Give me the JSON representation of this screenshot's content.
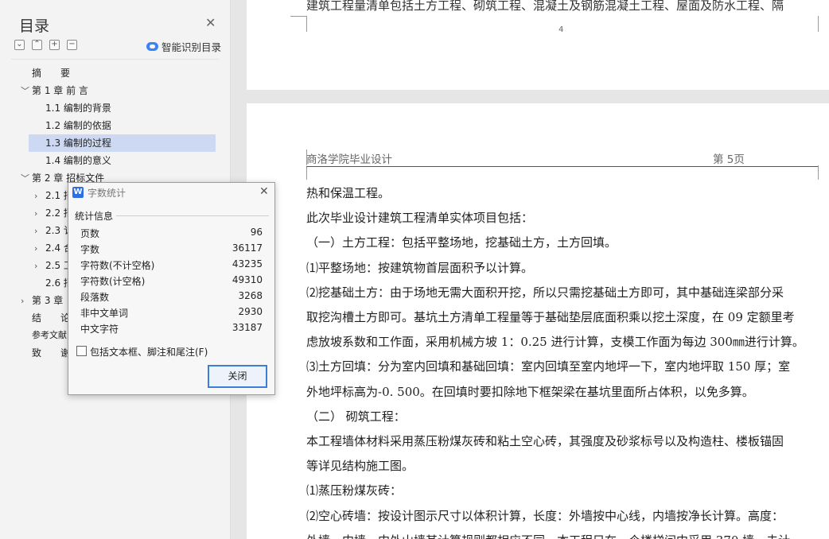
{
  "toc": {
    "title": "目录",
    "smart_label": "智能识别目录",
    "items": [
      {
        "label": "摘　　要"
      },
      {
        "label": "第 1 章  前  言"
      },
      {
        "label": "1.1 编制的背景"
      },
      {
        "label": "1.2 编制的依据"
      },
      {
        "label": "1.3 编制的过程"
      },
      {
        "label": "1.4 编制的意义"
      },
      {
        "label": "第 2 章  招标文件"
      },
      {
        "label": "2.1 招"
      },
      {
        "label": "2.2 招"
      },
      {
        "label": "2.3 讠"
      },
      {
        "label": "2.4 合"
      },
      {
        "label": "2.5 工"
      },
      {
        "label": "2.6 招"
      },
      {
        "label": "第 3 章"
      },
      {
        "label": "结　　论"
      },
      {
        "label": "参考文献"
      },
      {
        "label": "致　　谢"
      }
    ]
  },
  "document": {
    "prev_page_cut_text": "建筑工程量清单包括土方工程、砌筑工程、混凝土及钢筋混凝土工程、屋面及防水工程、隔",
    "prev_page_number": "4",
    "header_left": "商洛学院毕业设计",
    "header_right": "第 5页",
    "lines": [
      "热和保温工程。",
      "此次毕业设计建筑工程清单实体项目包括：",
      "（一）土方工程：包括平整场地，挖基础土方，土方回填。",
      "⑴平整场地：按建筑物首层面积予以计算。",
      "⑵挖基础土方：由于场地无需大面积开挖，所以只需挖基础土方即可，其中基础连梁部分采",
      "取挖沟槽土方即可。基坑土方清单工程量等于基础垫层底面积乘以挖土深度，在 09 定额里考",
      "虑放坡系数和工作面，采用机械方坡 1：0.25 进行计算，支模工作面为每边 300㎜进行计算。",
      "⑶土方回填：分为室内回填和基础回填：室内回填至室内地坪一下，室内地坪取 150 厚；室",
      "外地坪标高为-0. 500。在回填时要扣除地下框架梁在基坑里面所占体积，以免多算。",
      "（二） 砌筑工程：",
      "本工程墙体材料采用蒸压粉煤灰砖和粘土空心砖，其强度及砂浆标号以及构造柱、楼板锚固",
      "等详见结构施工图。",
      "⑴蒸压粉煤灰砖：",
      "⑵空心砖墙：按设计图示尺寸以体积计算，长度：外墙按中心线，内墙按净长计算。高度：",
      "外墙、内墙、内外山墙其计算规则都相应不同。本工程只在一个楼梯间中采用 370 墙，未计"
    ]
  },
  "dialog": {
    "title": "字数统计",
    "section": "统计信息",
    "stats": [
      {
        "label": "页数",
        "value": "96"
      },
      {
        "label": "字数",
        "value": "36117"
      },
      {
        "label": "字符数(不计空格)",
        "value": "43235"
      },
      {
        "label": "字符数(计空格)",
        "value": "49310"
      },
      {
        "label": "段落数",
        "value": "3268"
      },
      {
        "label": "非中文单词",
        "value": "2930"
      },
      {
        "label": "中文字符",
        "value": "33187"
      }
    ],
    "checkbox_label": "包括文本框、脚注和尾注(F)",
    "close_button": "关闭"
  },
  "colors": {
    "selected_toc_bg": "#cdd9f3",
    "accent": "#3c7fd6"
  }
}
